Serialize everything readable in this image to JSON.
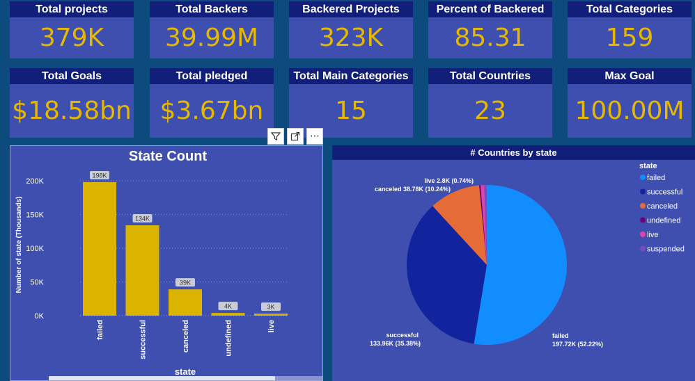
{
  "kpis_row1": [
    {
      "label": "Total projects",
      "value": "379K"
    },
    {
      "label": "Total Backers",
      "value": "39.99M"
    },
    {
      "label": "Backered Projects",
      "value": "323K"
    },
    {
      "label": "Percent of Backered",
      "value": "85.31"
    },
    {
      "label": "Total Categories",
      "value": "159"
    }
  ],
  "kpis_row2": [
    {
      "label": "Total Goals",
      "value": "$18.58bn"
    },
    {
      "label": "Total pledged",
      "value": "$3.67bn"
    },
    {
      "label": "Total Main Categories",
      "value": "15"
    },
    {
      "label": "Total Countries",
      "value": "23"
    },
    {
      "label": "Max Goal",
      "value": "100.00M"
    }
  ],
  "toolbar": {
    "filter_icon": "filter-icon",
    "focus_icon": "focus-mode-icon",
    "more_icon": "more-options-icon",
    "more_label": "⋯"
  },
  "colors": {
    "bar": "#dbb400",
    "panel": "#3f4fb0",
    "header": "#121f7a",
    "kpi_value": "#e6b800"
  },
  "chart_data": [
    {
      "type": "bar",
      "title": "State Count",
      "xlabel": "state",
      "ylabel": "Number of state (Thousands)",
      "categories": [
        "failed",
        "successful",
        "canceled",
        "undefined",
        "live"
      ],
      "values": [
        198,
        134,
        39,
        4,
        3
      ],
      "data_labels": [
        "198K",
        "134K",
        "39K",
        "4K",
        "3K"
      ],
      "ylim": [
        0,
        200
      ],
      "yticks": [
        0,
        50,
        100,
        150,
        200
      ],
      "ytick_labels": [
        "0K",
        "50K",
        "100K",
        "150K",
        "200K"
      ],
      "grid": true
    },
    {
      "type": "pie",
      "title": "# Countries by state",
      "legend_title": "state",
      "legend_position": "right",
      "categories": [
        "failed",
        "successful",
        "canceled",
        "undefined",
        "live",
        "suspended"
      ],
      "values": [
        197.72,
        133.96,
        38.78,
        1.05,
        2.8,
        1.85
      ],
      "colors": [
        "#118dff",
        "#12239e",
        "#e66c37",
        "#6b007b",
        "#e044a7",
        "#744ec2"
      ],
      "slice_labels": [
        {
          "name": "failed",
          "text": "197.72K (52.22%)"
        },
        {
          "name": "successful",
          "text": "133.96K (35.38%)"
        },
        {
          "name": "canceled",
          "text": "canceled 38.78K (10.24%)"
        },
        {
          "name": "live",
          "text": "live 2.8K (0.74%)"
        }
      ]
    }
  ]
}
